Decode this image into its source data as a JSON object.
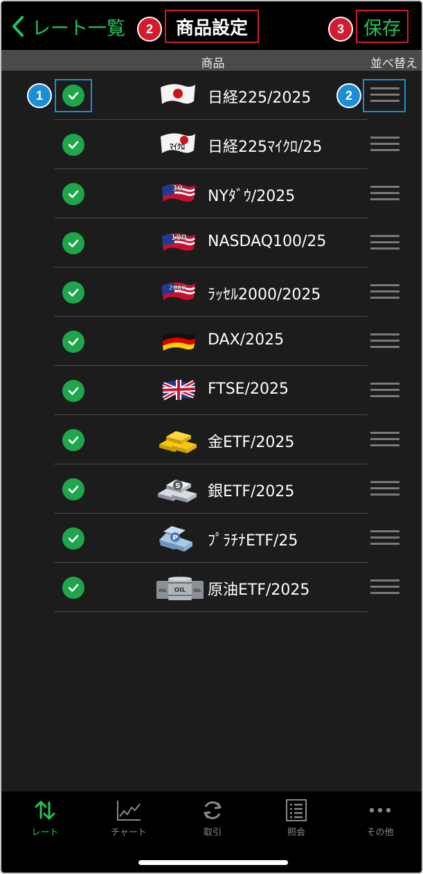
{
  "header": {
    "back_label": "レート一覧",
    "title": "商品設定",
    "save_label": "保存",
    "badges": {
      "title": "2",
      "save": "3",
      "check": "1",
      "handle": "2"
    }
  },
  "columns": {
    "product": "商品",
    "sort": "並べ替え"
  },
  "products": [
    {
      "name": "日経225/2025",
      "icon": "japan-flag-icon",
      "checked": true
    },
    {
      "name": "日経225ﾏｲｸﾛ/25",
      "icon": "japan-micro-flag-icon",
      "icon_text": "ﾏｲｸﾛ",
      "checked": true
    },
    {
      "name": "NYﾀﾞｳ/2025",
      "icon": "us-flag-30-icon",
      "icon_text": "30",
      "checked": true
    },
    {
      "name": "NASDAQ100/25",
      "icon": "us-flag-100-icon",
      "icon_text": "100",
      "checked": true
    },
    {
      "name": "ﾗｯｾﾙ2000/2025",
      "icon": "us-flag-2000-icon",
      "icon_text": "2000",
      "checked": true
    },
    {
      "name": "DAX/2025",
      "icon": "germany-flag-icon",
      "checked": true
    },
    {
      "name": "FTSE/2025",
      "icon": "uk-flag-icon",
      "checked": true
    },
    {
      "name": "金ETF/2025",
      "icon": "gold-bars-icon",
      "checked": true
    },
    {
      "name": "銀ETF/2025",
      "icon": "silver-bars-icon",
      "icon_text": "S",
      "checked": true
    },
    {
      "name": "ﾌﾟﾗﾁﾅETF/25",
      "icon": "platinum-bars-icon",
      "icon_text": "P",
      "checked": true
    },
    {
      "name": "原油ETF/2025",
      "icon": "oil-barrels-icon",
      "icon_text": "OIL",
      "checked": true
    }
  ],
  "tabs": [
    {
      "label": "レート",
      "icon": "rate-arrows-icon",
      "active": true
    },
    {
      "label": "チャート",
      "icon": "chart-icon",
      "active": false
    },
    {
      "label": "取引",
      "icon": "refresh-icon",
      "active": false
    },
    {
      "label": "照会",
      "icon": "list-icon",
      "active": false
    },
    {
      "label": "その他",
      "icon": "more-icon",
      "active": false
    }
  ],
  "colors": {
    "accent": "#22c55e",
    "annotation_red": "#d21b2d",
    "annotation_blue": "#1b8fd6",
    "check": "#1fa64a"
  }
}
